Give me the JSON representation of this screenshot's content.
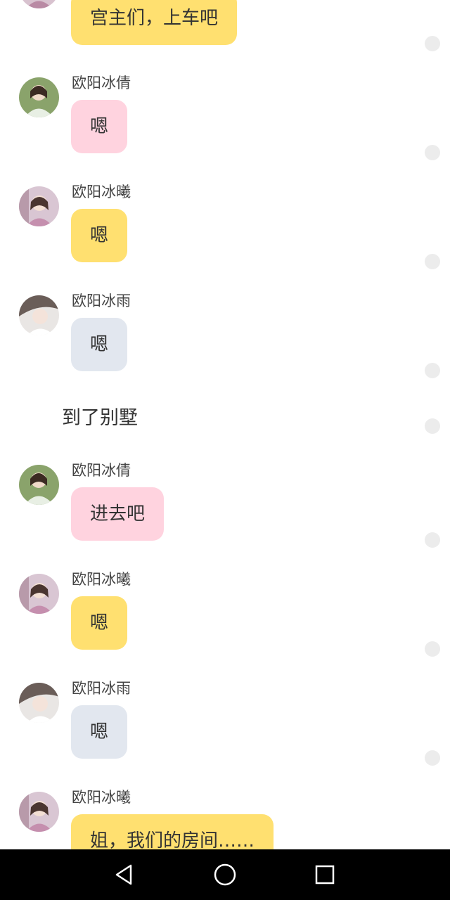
{
  "messages": [
    {
      "sender": "",
      "text": "宫主们，上车吧",
      "color": "yellow"
    },
    {
      "sender": "欧阳冰倩",
      "text": "嗯",
      "color": "pink"
    },
    {
      "sender": "欧阳冰曦",
      "text": "嗯",
      "color": "yellow"
    },
    {
      "sender": "欧阳冰雨",
      "text": "嗯",
      "color": "gray"
    },
    {
      "narration": "到了别墅"
    },
    {
      "sender": "欧阳冰倩",
      "text": "进去吧",
      "color": "pink"
    },
    {
      "sender": "欧阳冰曦",
      "text": "嗯",
      "color": "yellow"
    },
    {
      "sender": "欧阳冰雨",
      "text": "嗯",
      "color": "gray"
    },
    {
      "sender": "欧阳冰曦",
      "text": "姐，我们的房间……",
      "color": "yellow"
    }
  ],
  "colors": {
    "pink_bubble": "#ffd3df",
    "yellow_bubble": "#ffe070",
    "gray_bubble": "#e2e7ef",
    "navbar": "#000000"
  },
  "navbar": {
    "back_icon": "back-triangle-icon",
    "home_icon": "home-circle-icon",
    "recents_icon": "recents-square-icon"
  }
}
